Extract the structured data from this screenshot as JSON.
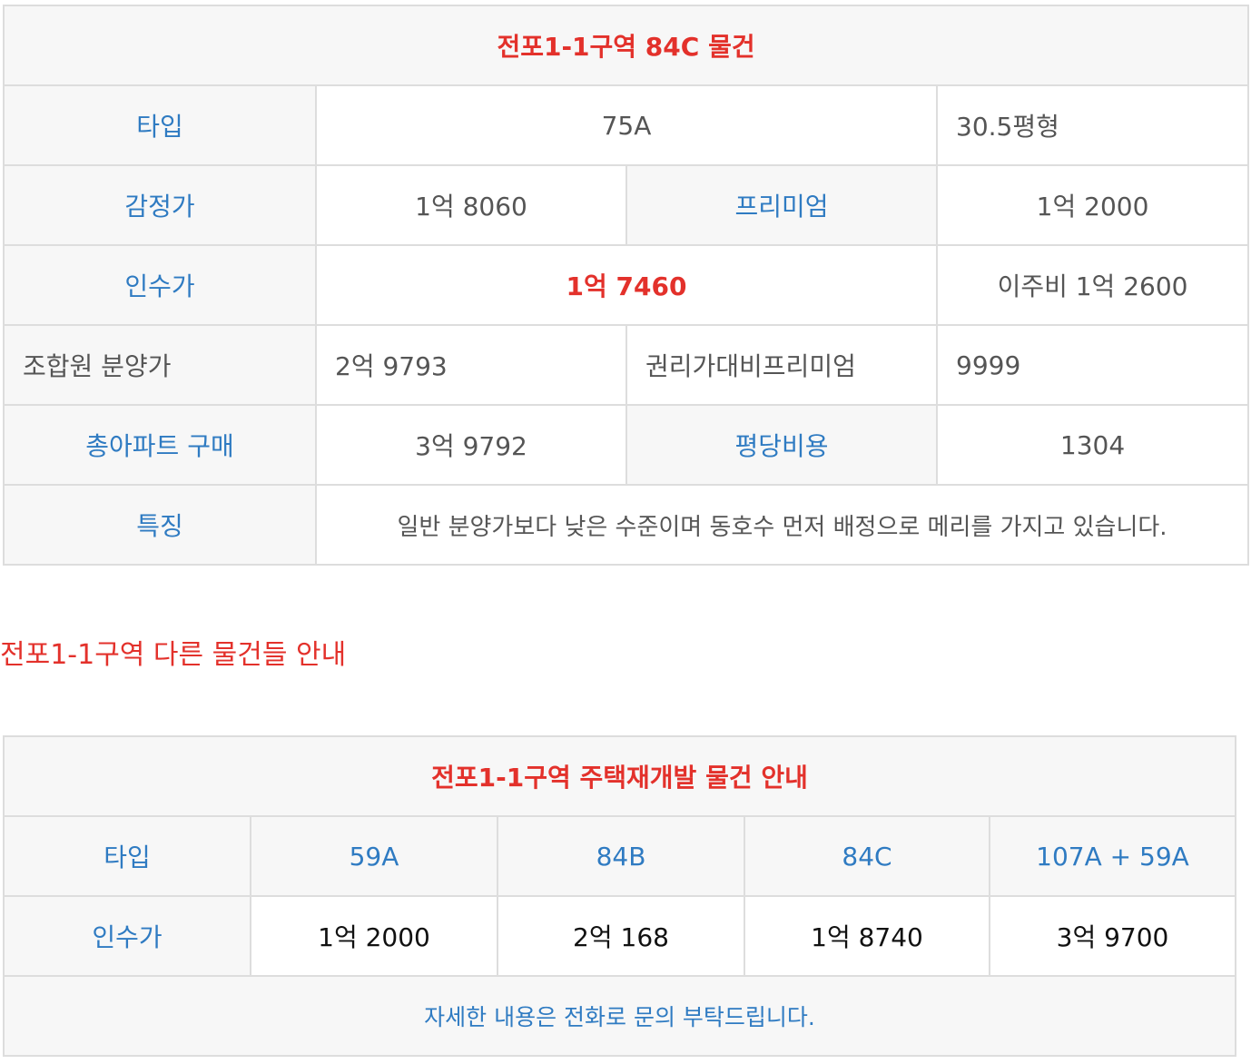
{
  "listing": {
    "title": "전포1-1구역 84C 물건",
    "type_label": "타입",
    "type_value": "75A",
    "type_size": "30.5평형",
    "appraisal_label": "감정가",
    "appraisal_value": "1억 8060",
    "premium_label": "프리미엄",
    "premium_value": "1억 2000",
    "acquisition_label": "인수가",
    "acquisition_value": "1억 7460",
    "relocation": "이주비 1억 2600",
    "member_price_label": "조합원 분양가",
    "member_price_value": "2억 9793",
    "rights_premium_label": "권리가대비프리미엄",
    "rights_premium_value": "9999",
    "total_label": "총아파트 구매",
    "total_value": "3억 9792",
    "per_pyeong_label": "평당비용",
    "per_pyeong_value": "1304",
    "feature_label": "특징",
    "feature_value": "일반 분양가보다 낮은 수준이며 동호수 먼저 배정으로 메리를 가지고 있습니다."
  },
  "other_heading": "전포1-1구역 다른 물건들 안내",
  "others": {
    "title": "전포1-1구역 주택재개발 물건 안내",
    "type_label": "타입",
    "price_label": "인수가",
    "columns": [
      {
        "type": "59A",
        "price": "1억 2000"
      },
      {
        "type": "84B",
        "price": "2억 168"
      },
      {
        "type": "84C",
        "price": "1억 8740"
      },
      {
        "type": "107A + 59A",
        "price": "3억 9700"
      }
    ],
    "note": "자세한 내용은 전화로 문의 부탁드립니다."
  },
  "colors": {
    "accent_red": "#e3312b",
    "label_blue": "#2f7bc2",
    "header_bg": "#f7f7f7",
    "border": "#dddddd"
  }
}
